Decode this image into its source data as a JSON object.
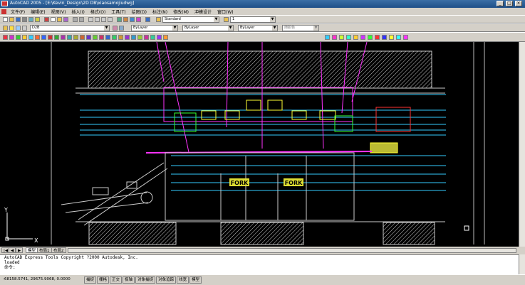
{
  "window": {
    "title": "AutoCAD 2005 - [E:\\Kevin_Design\\2D DB\\xiaosamojiudwg]",
    "buttons": [
      "_",
      "□",
      "×"
    ]
  },
  "menu": {
    "items": [
      "文件(F)",
      "编辑(E)",
      "视图(V)",
      "插入(I)",
      "格式(O)",
      "工具(T)",
      "绘图(D)",
      "标注(N)",
      "修改(M)",
      "冲模设计",
      "窗口(W)"
    ]
  },
  "toolbar": {
    "text_style": "Standard",
    "dim_scale": "1",
    "layer": "D2B",
    "color": "ByLayer",
    "linetype": "ByLayer",
    "lineweight": "ByLayer",
    "plot_style": "随颜色"
  },
  "drawing": {
    "labels": [
      "FORK",
      "FORK"
    ],
    "ucs_x": "X",
    "ucs_y": "Y",
    "model_tab_label": "模型"
  },
  "tabs": [
    "模型",
    "布局1",
    "布局2"
  ],
  "command": {
    "lines": [
      "AutoCAD Express Tools Copyright ?2000 Autodesk, Inc.",
      "loaded"
    ],
    "prompt": "命令:"
  },
  "status": {
    "coords": "-68158.5741, 29675.9068, 0.0000",
    "toggles": [
      "捕捉",
      "栅格",
      "正交",
      "极轴",
      "对象捕捉",
      "对象追踪",
      "线宽",
      "模型"
    ]
  },
  "colors": {
    "background": "#000000",
    "ui": "#d4d0c8",
    "title": "#1e4f88"
  }
}
